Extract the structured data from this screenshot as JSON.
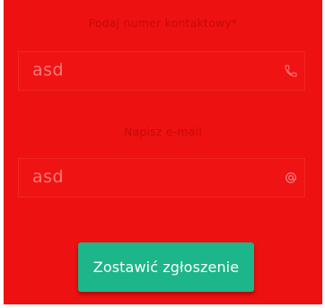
{
  "form": {
    "phone": {
      "label": "Podaj numer kontaktowy*",
      "value": "asd",
      "icon": "phone-icon"
    },
    "email": {
      "label": "Napisz e-mail",
      "value": "asd",
      "icon": "at-icon"
    },
    "submit_label": "Zostawić zgłoszenie"
  },
  "colors": {
    "background": "#ee1111",
    "button": "#1db58a",
    "button_text": "#ffffff"
  }
}
